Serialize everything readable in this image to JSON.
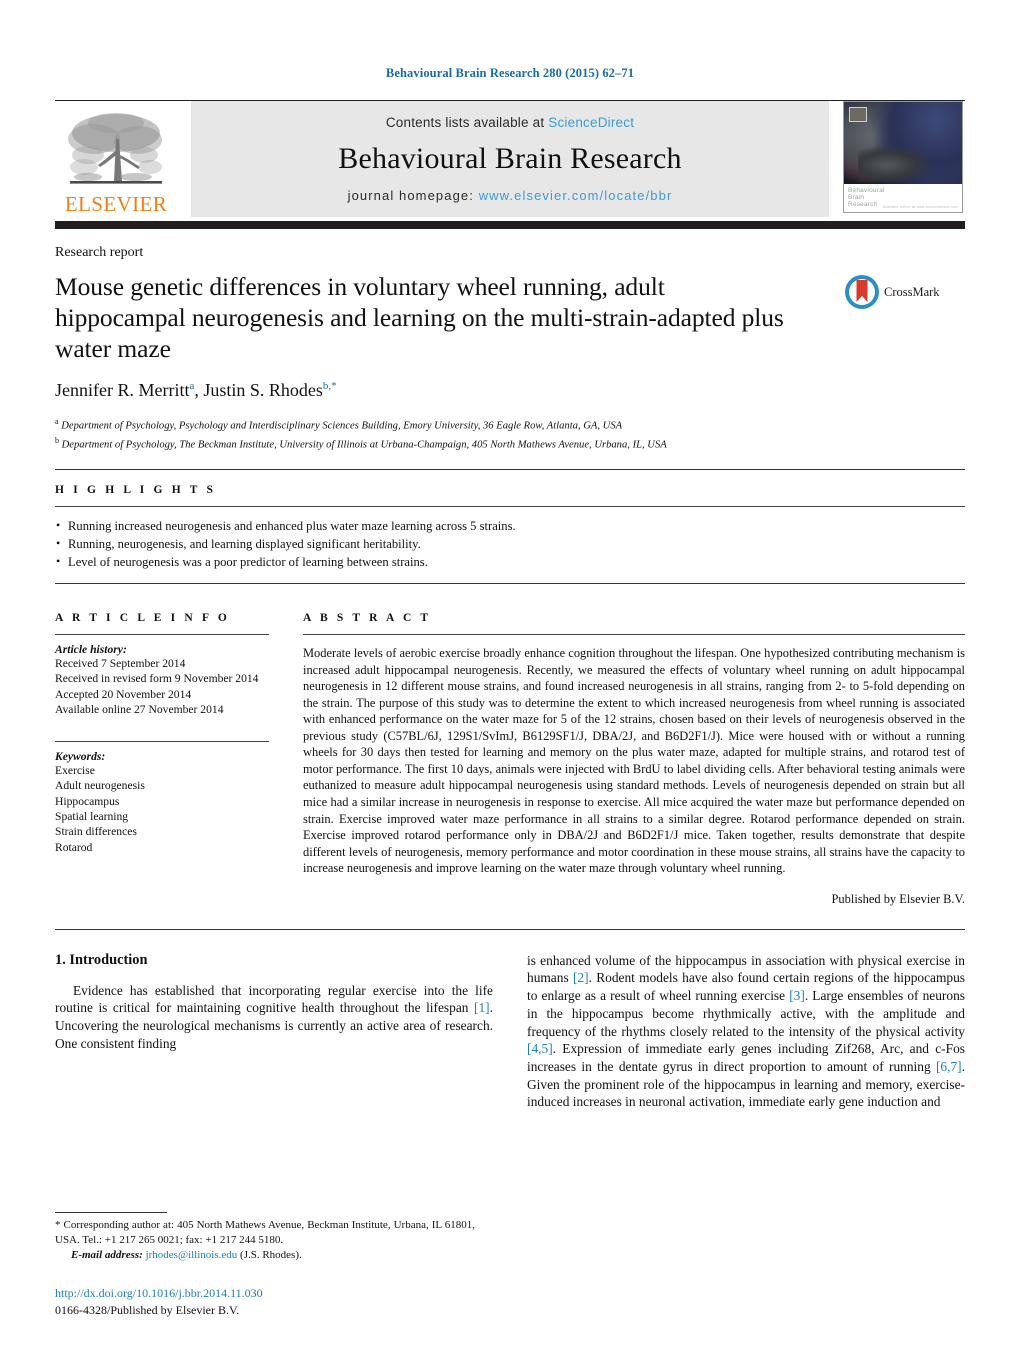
{
  "running_head": "Behavioural Brain Research 280 (2015) 62–71",
  "masthead": {
    "contents_prefix": "Contents lists available at ",
    "sciencedirect": "ScienceDirect",
    "journal_title": "Behavioural Brain Research",
    "homepage_prefix": "journal homepage: ",
    "homepage_url": "www.elsevier.com/locate/bbr",
    "publisher_logo_word": "ELSEVIER",
    "cover_label": "Behavioural\nBrain\nResearch",
    "cover_label_line1": "Behavioural",
    "cover_label_line2": "Brain",
    "cover_label_line3": "Research",
    "cover_label_sub": "available online at www.sciencedirect.com",
    "colors": {
      "banner_bg": "#e7e7e8",
      "link_blue": "#3c9bd6",
      "elsevier_orange": "#f07f13",
      "rule_black": "#231f20"
    }
  },
  "article": {
    "type": "Research report",
    "title": "Mouse genetic differences in voluntary wheel running, adult hippocampal neurogenesis and learning on the multi-strain-adapted plus water maze",
    "crossmark_label": "CrossMark",
    "authors_html": "Jennifer R. Merritt, Justin S. Rhodes",
    "author1": "Jennifer R. Merritt",
    "author1_sup": "a",
    "author2": "Justin S. Rhodes",
    "author2_sup": "b,*",
    "affiliation_a_sup": "a",
    "affiliation_a": "Department of Psychology, Psychology and Interdisciplinary Sciences Building, Emory University, 36 Eagle Row, Atlanta, GA, USA",
    "affiliation_b_sup": "b",
    "affiliation_b": "Department of Psychology, The Beckman Institute, University of Illinois at Urbana-Champaign, 405 North Mathews Avenue, Urbana, IL, USA"
  },
  "highlights": {
    "heading": "H I G H L I G H T S",
    "items": [
      "Running increased neurogenesis and enhanced plus water maze learning across 5 strains.",
      "Running, neurogenesis, and learning displayed significant heritability.",
      "Level of neurogenesis was a poor predictor of learning between strains."
    ]
  },
  "article_info": {
    "heading": "A R T I C L E    I N F O",
    "history_label": "Article history:",
    "history": [
      "Received 7 September 2014",
      "Received in revised form 9 November 2014",
      "Accepted 20 November 2014",
      "Available online 27 November 2014"
    ],
    "keywords_label": "Keywords:",
    "keywords": [
      "Exercise",
      "Adult neurogenesis",
      "Hippocampus",
      "Spatial learning",
      "Strain differences",
      "Rotarod"
    ]
  },
  "abstract": {
    "heading": "A B S T R A C T",
    "text": "Moderate levels of aerobic exercise broadly enhance cognition throughout the lifespan. One hypothesized contributing mechanism is increased adult hippocampal neurogenesis. Recently, we measured the effects of voluntary wheel running on adult hippocampal neurogenesis in 12 different mouse strains, and found increased neurogenesis in all strains, ranging from 2- to 5-fold depending on the strain. The purpose of this study was to determine the extent to which increased neurogenesis from wheel running is associated with enhanced performance on the water maze for 5 of the 12 strains, chosen based on their levels of neurogenesis observed in the previous study (C57BL/6J, 129S1/SvImJ, B6129SF1/J, DBA/2J, and B6D2F1/J). Mice were housed with or without a running wheels for 30 days then tested for learning and memory on the plus water maze, adapted for multiple strains, and rotarod test of motor performance. The first 10 days, animals were injected with BrdU to label dividing cells. After behavioral testing animals were euthanized to measure adult hippocampal neurogenesis using standard methods. Levels of neurogenesis depended on strain but all mice had a similar increase in neurogenesis in response to exercise. All mice acquired the water maze but performance depended on strain. Exercise improved water maze performance in all strains to a similar degree. Rotarod performance depended on strain. Exercise improved rotarod performance only in DBA/2J and B6D2F1/J mice. Taken together, results demonstrate that despite different levels of neurogenesis, memory performance and motor coordination in these mouse strains, all strains have the capacity to increase neurogenesis and improve learning on the water maze through voluntary wheel running.",
    "published_by": "Published by Elsevier B.V."
  },
  "introduction": {
    "heading": "1.  Introduction",
    "col1_para1_a": "Evidence has established that incorporating regular exercise into the life routine is critical for maintaining cognitive health throughout the lifespan ",
    "col1_ref1": "[1]",
    "col1_para1_b": ". Uncovering the neurological mechanisms is currently an active area of research. One consistent finding",
    "col2_a": "is enhanced volume of the hippocampus in association with physical exercise in humans ",
    "col2_ref2": "[2]",
    "col2_b": ". Rodent models have also found certain regions of the hippocampus to enlarge as a result of wheel running exercise ",
    "col2_ref3": "[3]",
    "col2_c": ". Large ensembles of neurons in the hippocampus become rhythmically active, with the amplitude and frequency of the rhythms closely related to the intensity of the physical activity ",
    "col2_ref45": "[4,5]",
    "col2_d": ". Expression of immediate early genes including Zif268, Arc, and c-Fos increases in the dentate gyrus in direct proportion to amount of running ",
    "col2_ref67": "[6,7]",
    "col2_e": ". Given the prominent role of the hippocampus in learning and memory, exercise-induced increases in neuronal activation, immediate early gene induction and"
  },
  "footer": {
    "corresponding_star": "*",
    "corresponding_text": "  Corresponding author at: 405 North Mathews Avenue, Beckman Institute, Urbana, IL 61801, USA. Tel.: +1 217 265 0021; fax: +1 217 244 5180.",
    "email_label": "E-mail address:",
    "email": "jrhodes@illinois.edu",
    "email_owner": "(J.S. Rhodes).",
    "doi": "http://dx.doi.org/10.1016/j.bbr.2014.11.030",
    "issn_line": "0166-4328/Published by Elsevier B.V."
  }
}
